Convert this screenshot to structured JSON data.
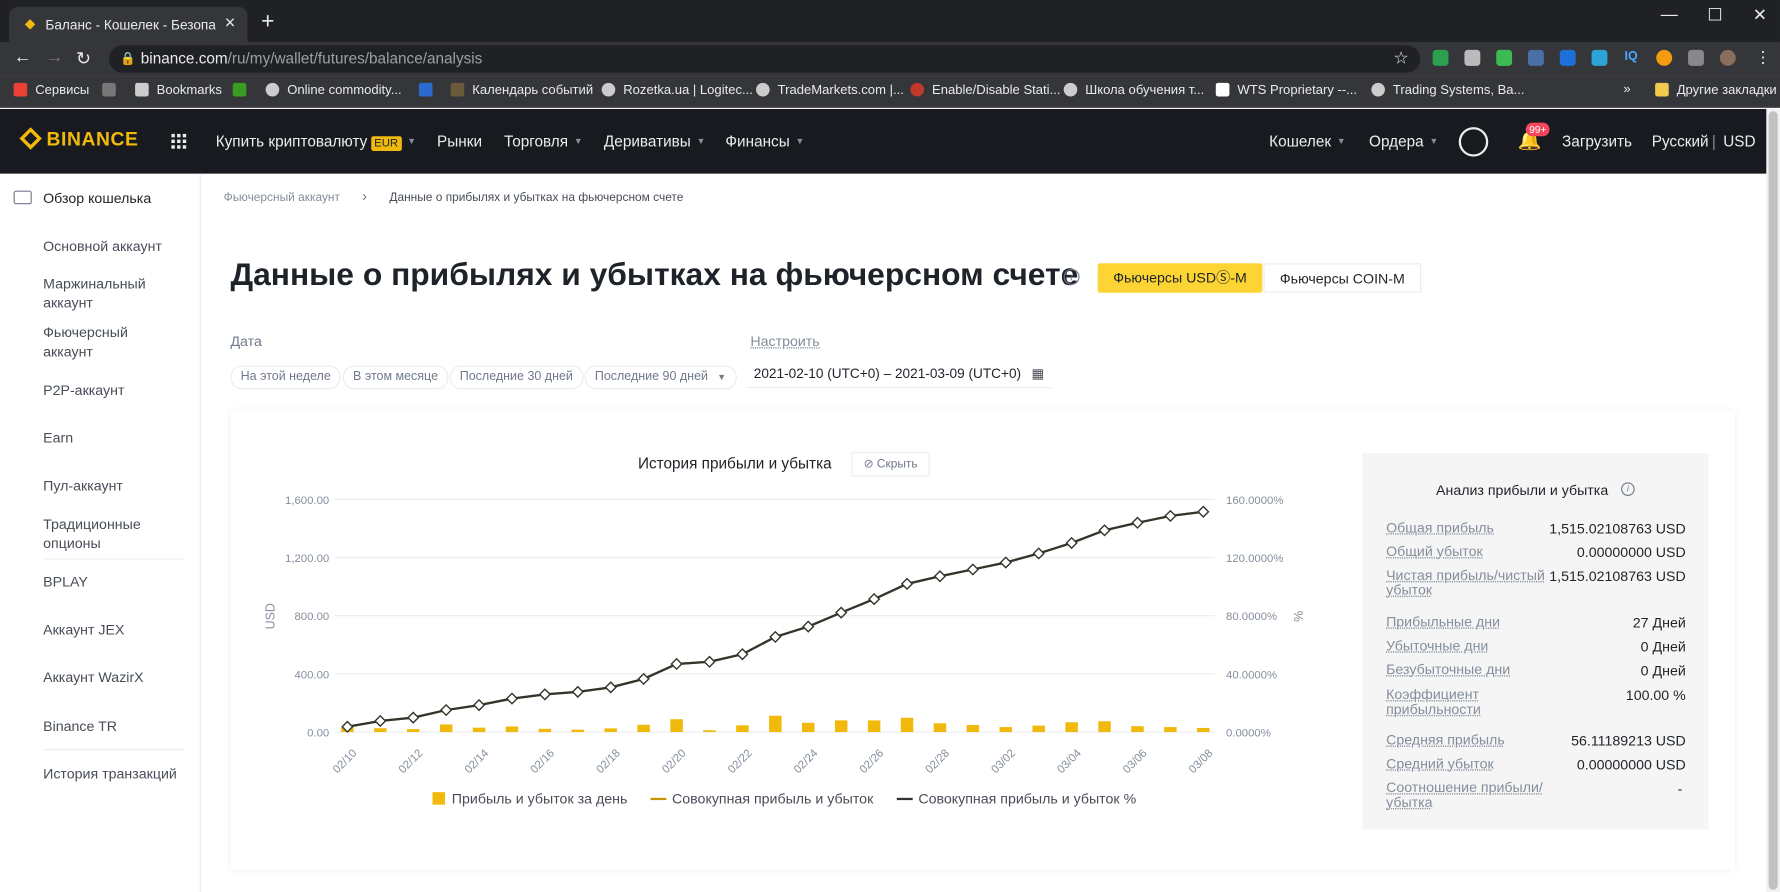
{
  "browser": {
    "tab_title": "Баланс - Кошелек - Безопасно",
    "url_host": "binance.com",
    "url_path": "/ru/my/wallet/futures/balance/analysis",
    "bookmarks": [
      "Сервисы",
      "Bookmarks",
      "Online commodity...",
      "Календарь событий",
      "Rozetka.ua | Logitec...",
      "TradeMarkets.com |...",
      "Enable/Disable Stati...",
      "Школа обучения т...",
      "WTS Proprietary --...",
      "Trading Systems, Ba..."
    ],
    "bookmarks_more": "»",
    "other_bookmarks": "Другие закладки",
    "extensions": [
      "IQ"
    ]
  },
  "header": {
    "logo": "BINANCE",
    "nav": [
      "Купить криптовалюту",
      "Рынки",
      "Торговля",
      "Деривативы",
      "Финансы"
    ],
    "eur_badge": "EUR",
    "wallet": "Кошелек",
    "orders": "Ордера",
    "notif_badge": "99+",
    "download": "Загрузить",
    "language": "Русский",
    "currency": "USD"
  },
  "sidebar": {
    "items": [
      "Обзор кошелька",
      "Основной аккаунт",
      "Маржинальный аккаунт",
      "Фьючерсный аккаунт",
      "P2P-аккаунт",
      "Earn",
      "Пул-аккаунт",
      "Традиционные опционы",
      "BPLAY",
      "Аккаунт JEX",
      "Аккаунт WazirX",
      "Binance TR",
      "История транзакций"
    ]
  },
  "breadcrumb": {
    "parent": "Фьючерсный аккаунт",
    "separator": "›",
    "current": "Данные о прибылях и убытках на фьючерсном счете"
  },
  "page": {
    "title": "Данные о прибылях и убытках на фьючерсном счете",
    "toggle_usdm": "Фьючерсы USDⓈ-M",
    "toggle_coinm": "Фьючерсы COIN-M",
    "date_label": "Дата",
    "customize": "Настроить",
    "chips": [
      "На этой неделе",
      "В этом месяце",
      "Последние 30 дней",
      "Последние 90 дней"
    ],
    "date_range": "2021-02-10 (UTC+0) – 2021-03-09 (UTC+0)"
  },
  "chart_title": "История прибыли и убытка",
  "hide_label": "Скрыть",
  "chart_data": {
    "type": "bar",
    "categories": [
      "02/10",
      "02/11",
      "02/12",
      "02/13",
      "02/14",
      "02/15",
      "02/16",
      "02/17",
      "02/18",
      "02/19",
      "02/20",
      "02/21",
      "02/22",
      "02/23",
      "02/24",
      "02/25",
      "02/26",
      "02/27",
      "02/28",
      "03/01",
      "03/02",
      "03/03",
      "03/04",
      "03/05",
      "03/06",
      "03/07",
      "03/08"
    ],
    "x_tick_labels": [
      "02/10",
      "02/12",
      "02/14",
      "02/16",
      "02/18",
      "02/20",
      "02/22",
      "02/24",
      "02/26",
      "02/28",
      "03/02",
      "03/04",
      "03/06",
      "03/08"
    ],
    "ylabel": "USD",
    "y2label": "%",
    "ylim": [
      0,
      1600
    ],
    "y_ticks": [
      "0.00",
      "400.00",
      "800.00",
      "1,200.00",
      "1,600.00"
    ],
    "y2lim": [
      0,
      160
    ],
    "y2_ticks": [
      "0.0000%",
      "40.0000%",
      "80.0000%",
      "120.0000%",
      "160.0000%"
    ],
    "series": [
      {
        "name": "Прибыль и убыток за день",
        "kind": "bar",
        "color": "#f0b90b",
        "values": [
          33,
          26,
          20,
          52,
          30,
          38,
          22,
          16,
          25,
          50,
          88,
          12,
          46,
          112,
          63,
          80,
          80,
          98,
          60,
          48,
          34,
          44,
          67,
          74,
          40,
          34,
          28
        ]
      },
      {
        "name": "Совокупная прибыль и убыток",
        "kind": "line",
        "color": "#c99400",
        "values": [
          36,
          76,
          99,
          151,
          185,
          230,
          259,
          276,
          307,
          365,
          468,
          483,
          535,
          654,
          725,
          821,
          914,
          1019,
          1071,
          1118,
          1166,
          1228,
          1300,
          1387,
          1439,
          1486,
          1515
        ]
      },
      {
        "name": "Совокупная прибыль и убыток %",
        "kind": "line",
        "color": "#333333",
        "values": [
          3.6,
          7.6,
          9.9,
          15.1,
          18.5,
          23.0,
          25.9,
          27.6,
          30.7,
          36.5,
          46.8,
          48.3,
          53.5,
          65.4,
          72.5,
          82.1,
          91.4,
          101.9,
          107.1,
          111.8,
          116.6,
          122.8,
          130.0,
          138.7,
          143.9,
          148.6,
          151.5
        ]
      }
    ],
    "legend": "bottom"
  },
  "analysis": {
    "title": "Анализ прибыли и убытка",
    "rows": [
      {
        "label": "Общая прибыль",
        "value": "1,515.02108763 USD"
      },
      {
        "label": "Общий убыток",
        "value": "0.00000000 USD"
      },
      {
        "label": "Чистая прибыль/чистый убыток",
        "value": "1,515.02108763 USD"
      },
      {
        "label": "Прибыльные дни",
        "value": "27 Дней"
      },
      {
        "label": "Убыточные дни",
        "value": "0 Дней"
      },
      {
        "label": "Безубыточные дни",
        "value": "0 Дней"
      },
      {
        "label": "Коэффициент прибыльности",
        "value": "100.00 %"
      },
      {
        "label": "Средняя прибыль",
        "value": "56.11189213 USD"
      },
      {
        "label": "Средний убыток",
        "value": "0.00000000 USD"
      },
      {
        "label": "Соотношение прибыли/убытка",
        "value": "-"
      }
    ]
  }
}
